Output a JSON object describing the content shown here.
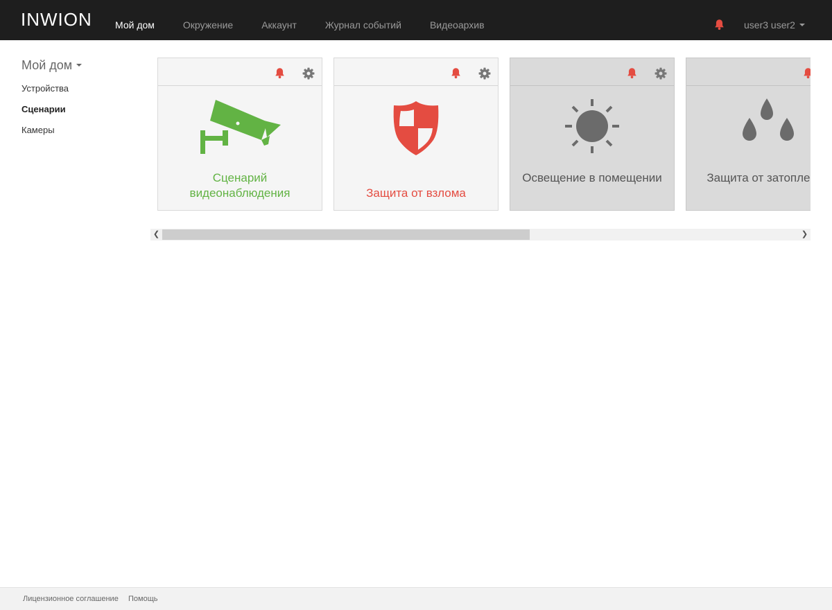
{
  "app": {
    "logo": "INWION"
  },
  "nav": {
    "items": [
      "Мой дом",
      "Окружение",
      "Аккаунт",
      "Журнал событий",
      "Видеоархив"
    ],
    "active_index": 0
  },
  "header": {
    "user_name": "user3 user2"
  },
  "sidebar": {
    "title": "Мой дом",
    "items": [
      "Устройства",
      "Сценарии",
      "Камеры"
    ],
    "active_index": 1
  },
  "cards": [
    {
      "label": "Сценарий видеонаблюдения",
      "icon": "camera-icon",
      "color": "#62b344",
      "background": "#f5f5f5"
    },
    {
      "label": "Защита от взлома",
      "icon": "shield-icon",
      "color": "#e44c41",
      "background": "#f5f5f5"
    },
    {
      "label": "Освещение в помещении",
      "icon": "sun-icon",
      "color": "#555555",
      "background": "#dadada"
    },
    {
      "label": "Защита от затопления",
      "icon": "water-drops-icon",
      "color": "#555555",
      "background": "#dadada"
    }
  ],
  "colors": {
    "topbar": "#1e1e1e",
    "alert": "#e44c41",
    "gear": "#777777",
    "accent_green": "#62b344"
  },
  "footer": {
    "links": [
      "Лицензионное соглашение",
      "Помощь"
    ]
  }
}
